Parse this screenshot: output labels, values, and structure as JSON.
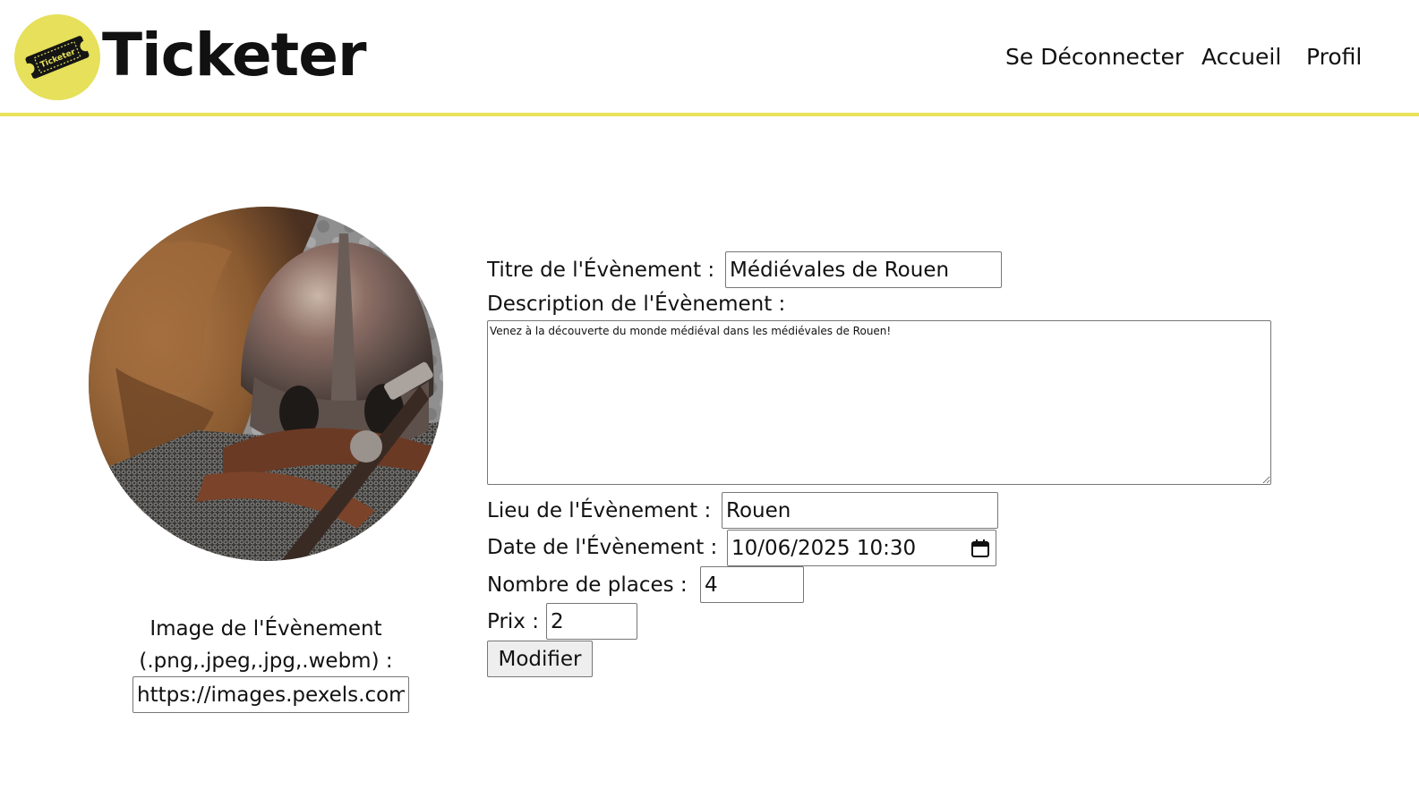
{
  "header": {
    "logo_badge_text": "Ticketer",
    "brand": "Ticketer",
    "nav": {
      "logout": "Se Déconnecter",
      "home": "Accueil",
      "profile": "Profil"
    }
  },
  "form": {
    "image_label": "Image de l'Évènement (.png,.jpeg,.jpg,.webm) :",
    "image_url_value": "https://images.pexels.com",
    "title_label": "Titre de l'Évènement :",
    "title_value": "Médiévales de Rouen",
    "description_label": "Description de l'Évènement :",
    "description_value": "Venez à la découverte du monde médiéval dans les médiévales de Rouen!",
    "place_label": "Lieu de l'Évènement :",
    "place_value": "Rouen",
    "date_label": "Date de l'Évènement :",
    "date_value": "10/06/2025 10:30",
    "seats_label": "Nombre de places :",
    "seats_value": "4",
    "price_label": "Prix :",
    "price_value": "2",
    "submit_label": "Modifier"
  },
  "icons": {
    "logo": "ticket-icon",
    "date_picker": "calendar-icon"
  },
  "colors": {
    "accent": "#e6e05a",
    "header_rule": "#e8e35a"
  }
}
